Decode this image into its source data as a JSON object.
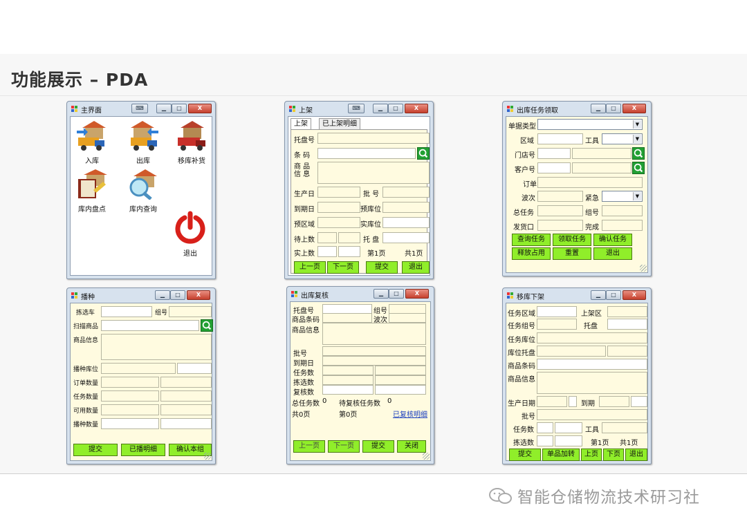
{
  "page": {
    "title": "功能展示 – PDA",
    "watermark": "智能仓储物流技术研习社"
  },
  "colors": {
    "window_frame": "#d7e2ee",
    "field_bg": "#fffbe0",
    "button_green": "#90ee2a",
    "search_green": "#22a033",
    "close_red": "#c5402d"
  },
  "main_menu": {
    "title": "主界面",
    "apps": [
      {
        "label": "入库",
        "icon": "truck-in-icon"
      },
      {
        "label": "出库",
        "icon": "truck-out-icon"
      },
      {
        "label": "移库补货",
        "icon": "truck-move-icon"
      },
      {
        "label": "库内盘点",
        "icon": "book-inventory-icon"
      },
      {
        "label": "库内查询",
        "icon": "magnifier-house-icon"
      }
    ],
    "exit_label": "退出"
  },
  "putaway": {
    "title": "上架",
    "tabs": [
      "上架",
      "已上架明细"
    ],
    "labels": {
      "pallet": "托盘号",
      "barcode": "条  码",
      "goods_info": "商 品 信 息",
      "prod_date": "生产日",
      "batch": "批  号",
      "expiry": "到期日",
      "pre_loc": "预库位",
      "pre_area": "预区域",
      "act_loc": "实库位",
      "pending_qty": "待上数",
      "pallet2": "托  盘",
      "act_qty": "实上数",
      "page_cur": "第1页",
      "page_total": "共1页"
    },
    "buttons": [
      "上一页",
      "下一页",
      "提交",
      "退出"
    ]
  },
  "outbound_task": {
    "title": "出库任务领取",
    "labels": {
      "doc_type": "单据类型",
      "area": "区域",
      "tool": "工具",
      "store": "门店号",
      "customer": "客户号",
      "order": "订单",
      "wave": "波次",
      "urgent": "紧急",
      "total_task": "总任务",
      "group": "组号",
      "dock": "发货口",
      "done": "完成"
    },
    "buttons": [
      "查询任务",
      "领取任务",
      "确认任务",
      "释放占用",
      "重置",
      "退出"
    ]
  },
  "picking": {
    "title": "播种",
    "labels": {
      "cart": "拣选车",
      "group": "组号",
      "scan": "扫描商品",
      "goods_info": "商品信息",
      "sow_loc": "播种库位",
      "order_qty": "订单数量",
      "task_qty": "任务数量",
      "avail_qty": "可用数量",
      "sow_qty": "播种数量"
    },
    "buttons": [
      "提交",
      "已播明细",
      "确认本组"
    ]
  },
  "outbound_review": {
    "title": "出库复核",
    "labels": {
      "pallet": "托盘号",
      "group": "组号",
      "barcode": "商品条码",
      "wave": "波次",
      "goods_info": "商品信息",
      "batch": "批号",
      "expiry": "到期日",
      "task_qty": "任务数",
      "picked_qty": "拣选数",
      "review_qty": "复核数",
      "total_tasks": "总任务数",
      "total_tasks_val": "0",
      "pending_review": "待复核任务数",
      "pending_review_val": "0",
      "page_total": "共0页",
      "page_cur": "第0页"
    },
    "link": "已复核明细",
    "buttons": [
      "上一页",
      "下一页",
      "提交",
      "关闭"
    ]
  },
  "move_off": {
    "title": "移库下架",
    "labels": {
      "task_area": "任务区域",
      "up_area": "上架区",
      "task_group": "任务组号",
      "pallet": "托盘",
      "task_loc": "任务库位",
      "loc_pallet": "库位托盘",
      "barcode": "商品条码",
      "goods_info": "商品信息",
      "prod_date": "生产日期",
      "expiry": "到期",
      "batch": "批号",
      "task_qty": "任务数",
      "tool": "工具",
      "picked_qty": "拣选数",
      "page_cur": "第1页",
      "page_total": "共1页"
    },
    "buttons": [
      "提交",
      "单品加转",
      "上页",
      "下页",
      "退出"
    ]
  }
}
